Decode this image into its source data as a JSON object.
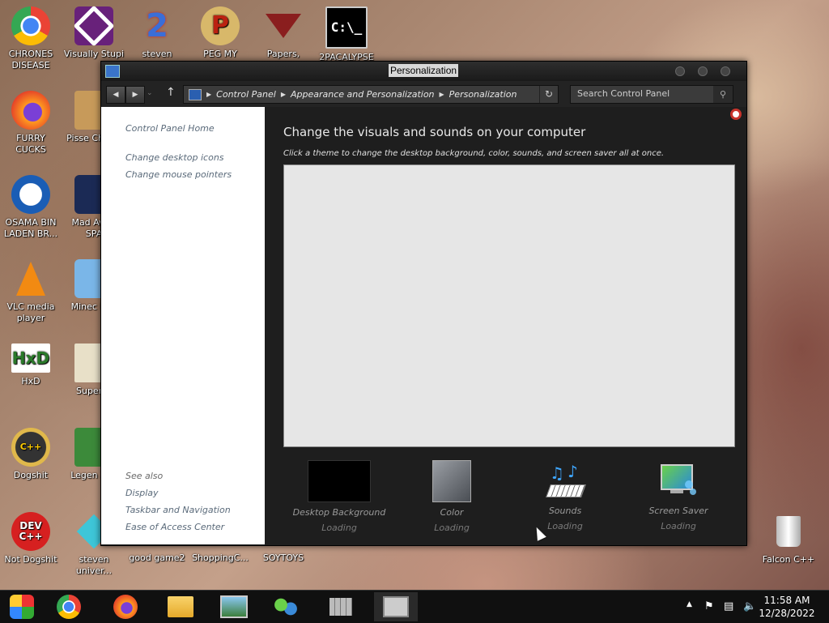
{
  "desktop": {
    "icons": [
      {
        "id": "chrones",
        "label": "CHRONES DISEASE",
        "icon": "chrome-icon"
      },
      {
        "id": "visually",
        "label": "Visually Stupi",
        "icon": "visual-studio-icon"
      },
      {
        "id": "steven",
        "label": "steven",
        "icon": "steam-2-icon"
      },
      {
        "id": "peg",
        "label": "PEG MY WIFE!",
        "icon": "peg-icon"
      },
      {
        "id": "papers",
        "label": "Papers,",
        "icon": "papers-please-icon"
      },
      {
        "id": "2pacalypse",
        "label": "2PACALYPSE",
        "icon": "cmd-icon"
      },
      {
        "id": "furry",
        "label": "FURRY CUCKS",
        "icon": "firefox-icon"
      },
      {
        "id": "pisser",
        "label": "Pisse Chicke",
        "icon": "game-icon"
      },
      {
        "id": "osama",
        "label": "OSAMA BIN LADEN BR...",
        "icon": "obama-logo-icon"
      },
      {
        "id": "madav",
        "label": "Mad Av IN SPA",
        "icon": "angry-birds-space-icon"
      },
      {
        "id": "vlc",
        "label": "VLC media player",
        "icon": "vlc-icon"
      },
      {
        "id": "minec",
        "label": "Minec Birc",
        "icon": "angry-birds-icon"
      },
      {
        "id": "hxd",
        "label": "HxD",
        "icon": "hxd-icon"
      },
      {
        "id": "superh",
        "label": "Super H",
        "icon": "pixel-game-icon"
      },
      {
        "id": "dogshit",
        "label": "Dogshit",
        "icon": "cpp-icon"
      },
      {
        "id": "legen",
        "label": "Legen Zild",
        "icon": "zelda-icon"
      },
      {
        "id": "notdogshit",
        "label": "Not Dogshit",
        "icon": "dev-cpp-icon"
      },
      {
        "id": "stevenu",
        "label": "steven univer...",
        "icon": "diamond-icon"
      },
      {
        "id": "goodgame",
        "label": "good game2",
        "icon": "file-icon"
      },
      {
        "id": "shopping",
        "label": "ShoppingC...",
        "icon": "file-icon"
      },
      {
        "id": "soytoys",
        "label": "SOYTOYS",
        "icon": "file-icon"
      },
      {
        "id": "falcon",
        "label": "Falcon C++",
        "icon": "recycle-bin-icon"
      }
    ]
  },
  "window": {
    "title": "Personalization",
    "breadcrumbs": [
      "Control Panel",
      "Appearance and Personalization",
      "Personalization"
    ],
    "search_placeholder": "Search Control Panel",
    "sidebar": {
      "top_links": [
        "Control Panel Home",
        "Change desktop icons",
        "Change mouse pointers"
      ],
      "see_also_heading": "See also",
      "see_also_links": [
        "Display",
        "Taskbar and Navigation",
        "Ease of Access Center"
      ]
    },
    "main": {
      "heading": "Change the visuals and sounds on your computer",
      "subheading": "Click a theme to change the desktop background, color, sounds, and screen saver all at once.",
      "tools": [
        {
          "label": "Desktop Background",
          "status": "Loading",
          "icon": "desktop-background-icon"
        },
        {
          "label": "Color",
          "status": "Loading",
          "icon": "color-icon"
        },
        {
          "label": "Sounds",
          "status": "Loading",
          "icon": "sounds-icon"
        },
        {
          "label": "Screen Saver",
          "status": "Loading",
          "icon": "screen-saver-icon"
        }
      ]
    }
  },
  "taskbar": {
    "time": "11:58 AM",
    "date": "12/28/2022",
    "apps": [
      "start-icon",
      "chrome-icon",
      "firefox-icon",
      "file-explorer-icon",
      "photos-icon",
      "network-icon",
      "control-panel-icon",
      "personalization-icon"
    ]
  }
}
